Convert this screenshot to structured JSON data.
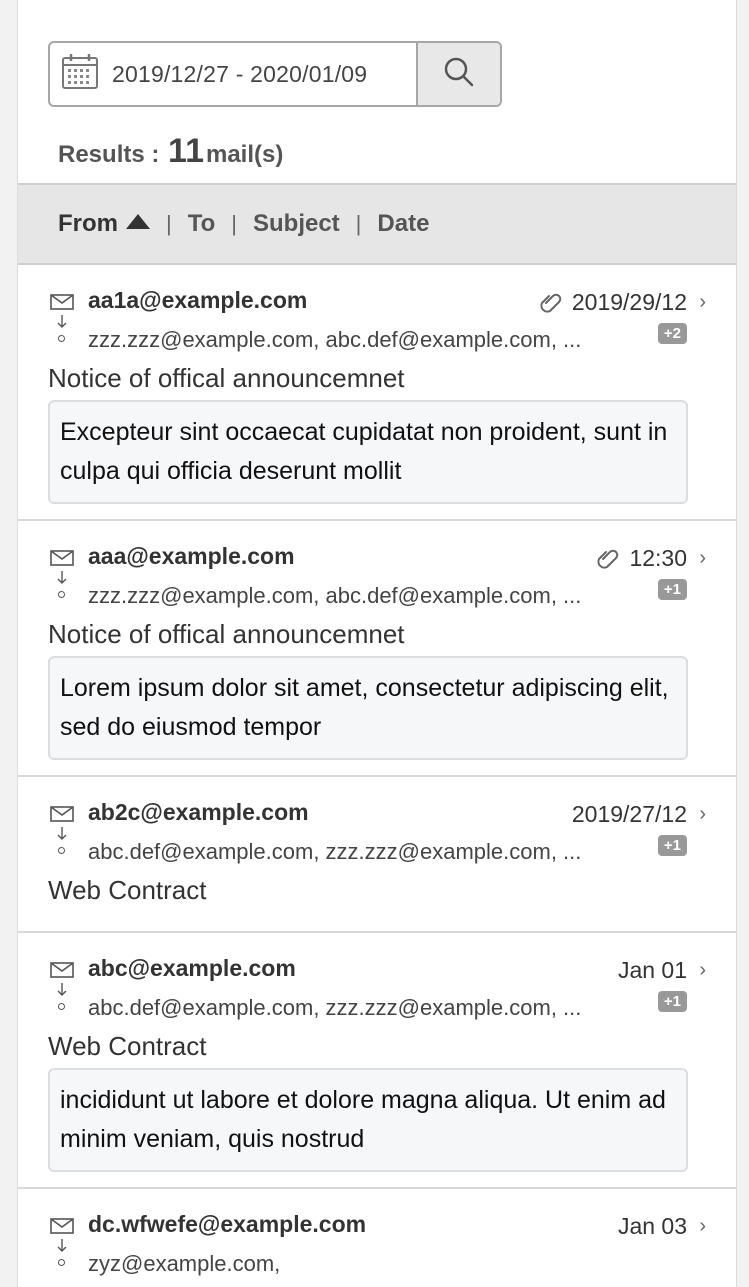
{
  "search": {
    "date_range": "2019/12/27 - 2020/01/09",
    "calendar_icon": "calendar-icon",
    "search_icon": "search-icon"
  },
  "results": {
    "label": "Results :",
    "count": "11",
    "unit": "mail(s)"
  },
  "sort": {
    "from": "From",
    "to": "To",
    "subject": "Subject",
    "date": "Date",
    "separator": "|",
    "active": "from",
    "direction": "ascending"
  },
  "mails": [
    {
      "from": "aa1a@example.com",
      "date": "2019/29/12",
      "attachment": true,
      "to": "zzz.zzz@example.com, abc.def@example.com, ...",
      "extra": "+2",
      "subject": "Notice of offical announcemnet",
      "preview": "Excepteur sint occaecat cupidatat non proident, sunt in culpa qui officia deserunt mollit"
    },
    {
      "from": "aaa@example.com",
      "date": "12:30",
      "attachment": true,
      "to": "zzz.zzz@example.com, abc.def@example.com, ...",
      "extra": "+1",
      "subject": "Notice of offical announcemnet",
      "preview": "Lorem ipsum dolor sit amet, consectetur adipiscing elit, sed do eiusmod tempor"
    },
    {
      "from": "ab2c@example.com",
      "date": "2019/27/12",
      "attachment": false,
      "to": "abc.def@example.com, zzz.zzz@example.com, ...",
      "extra": "+1",
      "subject": "Web Contract",
      "preview": ""
    },
    {
      "from": "abc@example.com",
      "date": "Jan 01",
      "attachment": false,
      "to": "abc.def@example.com, zzz.zzz@example.com, ...",
      "extra": "+1",
      "subject": "Web Contract",
      "preview": "incididunt ut labore et dolore magna aliqua. Ut enim ad minim veniam, quis nostrud"
    },
    {
      "from": "dc.wfwefe@example.com",
      "date": "Jan 03",
      "attachment": false,
      "to": "zyz@example.com,",
      "extra": "",
      "subject": "",
      "preview": ""
    }
  ],
  "colors": {
    "border": "#a6a6a6",
    "sortbar_bg": "#e6e6e6",
    "badge_bg": "#999999",
    "preview_bg": "#f6f7f9"
  }
}
